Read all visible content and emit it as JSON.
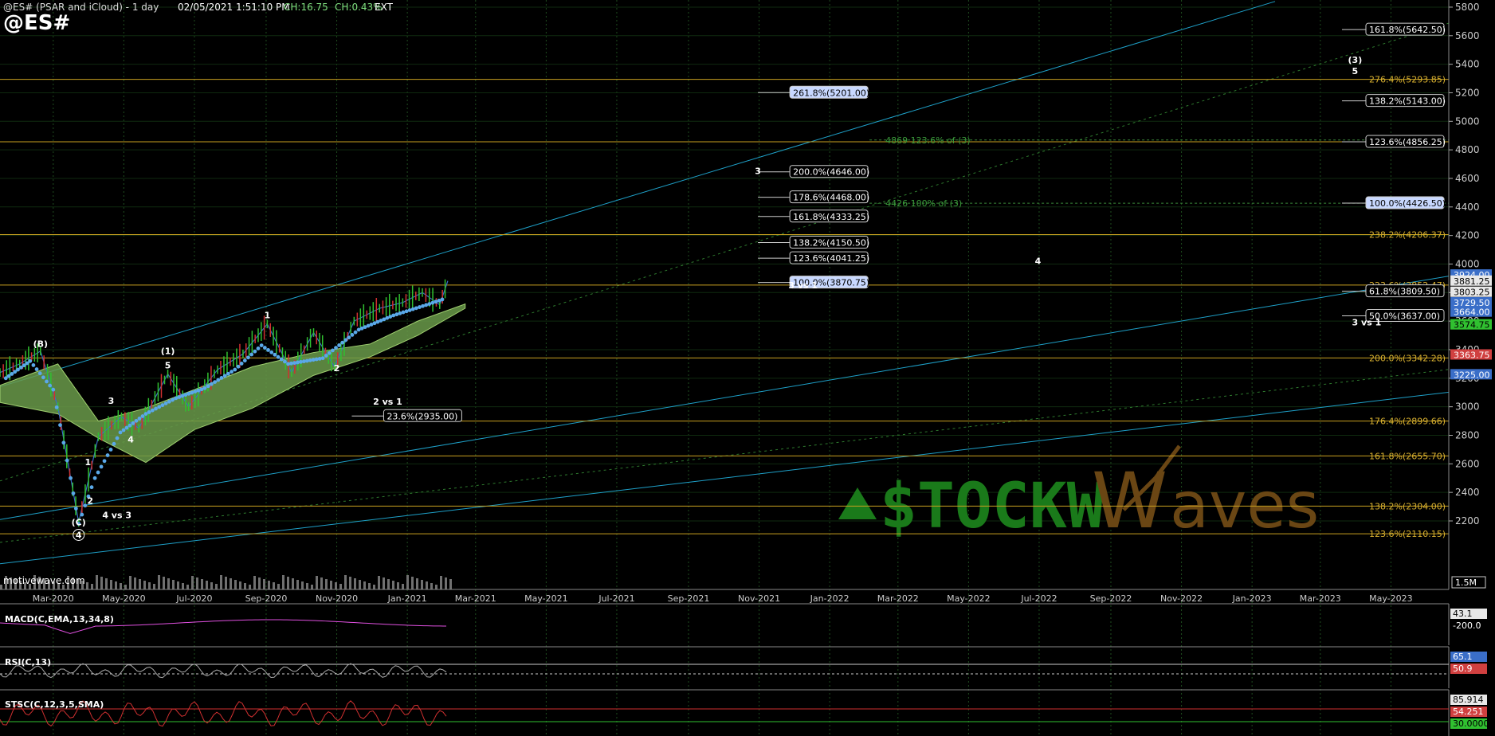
{
  "header": {
    "title": "@ES# (PSAR and iCloud) - 1 day",
    "datetime": "02/05/2021 1:51:10 PM",
    "change": "CH:16.75",
    "change_pct": "CH:0.43%",
    "session": "EXT",
    "symbol": "@ES#",
    "watermark_credit": "motivewave.com",
    "logo_text": "$TOCKWaves"
  },
  "colors": {
    "background": "#000000",
    "grid": "#1f4d1f",
    "fib_line": "#c8a020",
    "fib_text": "#d8b030",
    "channel": "#1ea0c8",
    "price_line": "#3a6ec8",
    "psar": "#5aa8e8",
    "cloud": "#6a9a4a",
    "up_candle": "#30c030",
    "down_candle": "#d03030",
    "label_box": "#000000",
    "highlight_box": "#c8d8ff",
    "macd": "#e050e0",
    "logo_green": "#1a7a1a",
    "logo_brown": "#6a4614"
  },
  "chart_data": {
    "type": "line",
    "title": "@ES# (PSAR and iCloud) - 1 day",
    "x_ticks": [
      "Mar-2020",
      "May-2020",
      "Jul-2020",
      "Sep-2020",
      "Nov-2020",
      "Jan-2021",
      "Mar-2021",
      "May-2021",
      "Jul-2021",
      "Sep-2021",
      "Nov-2021",
      "Jan-2022",
      "Mar-2022",
      "May-2022",
      "Jul-2022",
      "Sep-2022",
      "Nov-2022",
      "Jan-2023",
      "Mar-2023",
      "May-2023"
    ],
    "y_ticks": [
      2200,
      2400,
      2600,
      2800,
      3000,
      3200,
      3400,
      3600,
      3800,
      4000,
      4200,
      4400,
      4600,
      4800,
      5000,
      5200,
      5400,
      5600,
      5800
    ],
    "ylim": [
      1720,
      5850
    ],
    "series": [
      {
        "x": [
          "2020-01-15",
          "2020-02-01",
          "2020-02-19",
          "2020-03-05",
          "2020-03-23",
          "2020-04-09",
          "2020-04-29",
          "2020-05-14",
          "2020-06-08",
          "2020-06-26",
          "2020-07-21",
          "2020-08-12",
          "2020-09-02",
          "2020-09-23",
          "2020-10-12",
          "2020-10-30",
          "2020-11-16",
          "2020-12-08",
          "2020-12-28",
          "2021-01-14",
          "2021-01-29",
          "2021-02-05"
        ],
        "y": [
          3240,
          3300,
          3390,
          3000,
          2190,
          2790,
          2930,
          2850,
          3230,
          3000,
          3260,
          3370,
          3580,
          3240,
          3520,
          3280,
          3600,
          3690,
          3730,
          3800,
          3715,
          3882
        ]
      }
    ],
    "fib_lines": [
      {
        "value": 5293.85,
        "label": "276.4%(5293.85)"
      },
      {
        "value": 4856.25,
        "label": "123.6%(4856.25)"
      },
      {
        "value": 4206.37,
        "label": "238.2%(4206.37)"
      },
      {
        "value": 3852.47,
        "label": "223.6%(3852.47)"
      },
      {
        "value": 3342.28,
        "label": "200.0%(3342.28)"
      },
      {
        "value": 2899.66,
        "label": "176.4%(2899.66)"
      },
      {
        "value": 2655.7,
        "label": "161.8%(2655.70)"
      },
      {
        "value": 2304.0,
        "label": "138.2%(2304.00)"
      },
      {
        "value": 2110.15,
        "label": "123.6%(2110.15)"
      }
    ],
    "fib_labels_mid": [
      {
        "value": 5201.0,
        "label": "261.8%(5201.00)",
        "highlight": true
      },
      {
        "value": 4646.0,
        "label": "200.0%(4646.00)",
        "highlight": false
      },
      {
        "value": 4468.0,
        "label": "178.6%(4468.00)",
        "highlight": false
      },
      {
        "value": 4333.25,
        "label": "161.8%(4333.25)",
        "highlight": false
      },
      {
        "value": 4150.5,
        "label": "138.2%(4150.50)",
        "highlight": false
      },
      {
        "value": 4041.25,
        "label": "123.6%(4041.25)",
        "highlight": false
      },
      {
        "value": 3870.75,
        "label": "100.0%(3870.75)",
        "highlight": true
      },
      {
        "value": 2935.0,
        "label": "23.6%(2935.00)",
        "highlight": false
      }
    ],
    "fib_labels_right": [
      {
        "value": 5642.5,
        "label": "161.8%(5642.50)",
        "highlight": false
      },
      {
        "value": 5143.0,
        "label": "138.2%(5143.00)",
        "highlight": false
      },
      {
        "value": 4856.25,
        "label": "123.6%(4856.25)",
        "highlight": false
      },
      {
        "value": 4426.5,
        "label": "100.0%(4426.50)",
        "highlight": true
      },
      {
        "value": 3809.5,
        "label": "61.8%(3809.50)",
        "highlight": false
      },
      {
        "value": 3637.0,
        "label": "50.0%(3637.00)",
        "highlight": false
      }
    ],
    "green_notes": [
      {
        "value": 4869,
        "label": "4869 123.6% of (3)"
      },
      {
        "value": 4426,
        "label": "4426 100% of (3)"
      }
    ],
    "price_tags": [
      {
        "value": 3924.0,
        "label": "3924.00",
        "style": "blue"
      },
      {
        "value": 3881.25,
        "label": "3881.25",
        "style": "white"
      },
      {
        "value": 3803.25,
        "label": "3803.25",
        "style": "white"
      },
      {
        "value": 3729.5,
        "label": "3729.50",
        "style": "blue"
      },
      {
        "value": 3664.0,
        "label": "3664.00",
        "style": "blue"
      },
      {
        "value": 3574.75,
        "label": "3574.75",
        "style": "green"
      },
      {
        "value": 3363.75,
        "label": "3363.75",
        "style": "red"
      },
      {
        "value": 3225.0,
        "label": "3225.00",
        "style": "blue"
      }
    ],
    "wave_labels": [
      {
        "x": "2020-02-19",
        "value": 3420,
        "label": "(B)"
      },
      {
        "x": "2020-03-23",
        "value": 2170,
        "label": "(C)"
      },
      {
        "x": "2020-03-23",
        "value": 2080,
        "label": "4",
        "circled": true
      },
      {
        "x": "2020-03-31",
        "value": 2590,
        "label": "1"
      },
      {
        "x": "2020-04-02",
        "value": 2320,
        "label": "2"
      },
      {
        "x": "2020-04-20",
        "value": 3020,
        "label": "3"
      },
      {
        "x": "2020-05-07",
        "value": 2750,
        "label": "4"
      },
      {
        "x": "2020-06-08",
        "value": 3270,
        "label": "5"
      },
      {
        "x": "2020-06-08",
        "value": 3370,
        "label": "(1)"
      },
      {
        "x": "2020-09-02",
        "value": 3620,
        "label": "1"
      },
      {
        "x": "2020-11-01",
        "value": 3250,
        "label": "2"
      },
      {
        "x": "2021-10-31",
        "value": 4630,
        "label": "3"
      },
      {
        "x": "2022-06-30",
        "value": 4000,
        "label": "4"
      },
      {
        "x": "2023-03-31",
        "value": 5410,
        "label": "(3)"
      },
      {
        "x": "2023-03-31",
        "value": 5330,
        "label": "5"
      }
    ],
    "annotations": [
      {
        "x": "2020-12-15",
        "value": 3015,
        "label": "2 vs 1"
      },
      {
        "x": "2020-04-25",
        "value": 2220,
        "label": "4 vs 3"
      },
      {
        "x": "2021-12-09",
        "value": 3830,
        "label": "3 vs 1"
      },
      {
        "x": "2023-04-10",
        "value": 3570,
        "label": "3 vs 1"
      }
    ],
    "x_right_tag": "1.5M"
  },
  "panels": {
    "macd": {
      "label": "MACD(C,EMA,13,34,8)",
      "tags": [
        "43.1",
        "-200.0"
      ]
    },
    "rsi": {
      "label": "RSI(C,13)",
      "tags": [
        "65.1",
        "50.9"
      ]
    },
    "stoch": {
      "label": "STSC(C,12,3,5,SMA)",
      "tags": [
        "85.914",
        "54.251",
        "30.0000"
      ]
    }
  }
}
